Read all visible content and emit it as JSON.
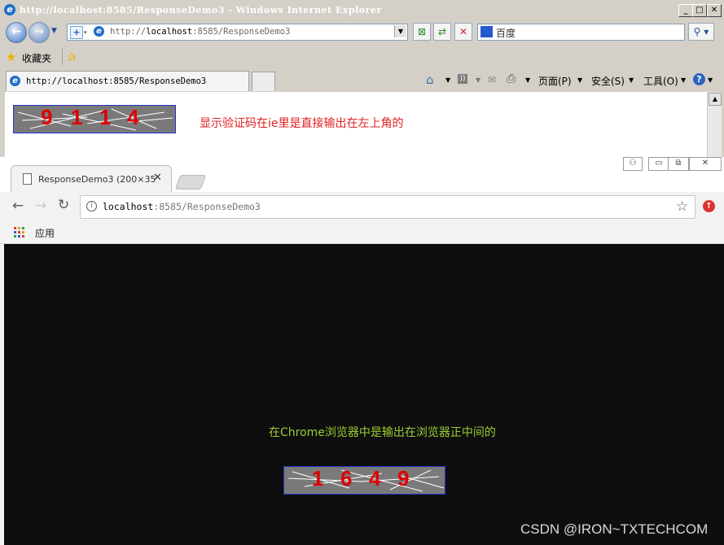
{
  "ie": {
    "title": "http://localhost:8585/ResponseDemo3 - Windows Internet Explorer",
    "address": "http://localhost:8585/ResponseDemo3",
    "address_host": "localhost",
    "address_prefix": "http://",
    "address_rest": ":8585/ResponseDemo3",
    "search_placeholder": "百度",
    "favorites_label": "收藏夹",
    "tab_title": "http://localhost:8585/ResponseDemo3",
    "cmd_page": "页面(P)",
    "cmd_safety": "安全(S)",
    "cmd_tools": "工具(O)",
    "captcha_digits": [
      "9",
      "1",
      "1",
      "4"
    ],
    "message": "显示验证码在ie里是直接输出在左上角的"
  },
  "chrome": {
    "tab_title": "ResponseDemo3 (200×35",
    "url_host": "localhost",
    "url_rest": ":8585/ResponseDemo3",
    "apps_label": "应用",
    "message": "在Chrome浏览器中是输出在浏览器正中间的",
    "captcha_digits": [
      "1",
      "6",
      "4",
      "9"
    ]
  },
  "watermark": "CSDN @IRON~TXTECHCOM",
  "colors": {
    "captcha_bg": "#7a7a7a",
    "captcha_digit": "#e00000",
    "ie_message": "#e02020",
    "chrome_message": "#9acd32",
    "page_dark": "#0e0e0e"
  },
  "icons": [
    "ie-logo-icon",
    "back-icon",
    "forward-icon",
    "dropdown-icon",
    "compat-view-icon",
    "refresh-icon",
    "stop-icon",
    "baidu-icon",
    "search-icon",
    "star-icon",
    "add-favorite-icon",
    "home-icon",
    "feed-icon",
    "mail-icon",
    "print-icon",
    "help-icon",
    "page-icon",
    "close-icon",
    "reload-icon",
    "info-icon",
    "bookmark-star-icon",
    "update-icon",
    "apps-grid-icon",
    "user-icon",
    "minimize-icon",
    "maximize-icon"
  ]
}
